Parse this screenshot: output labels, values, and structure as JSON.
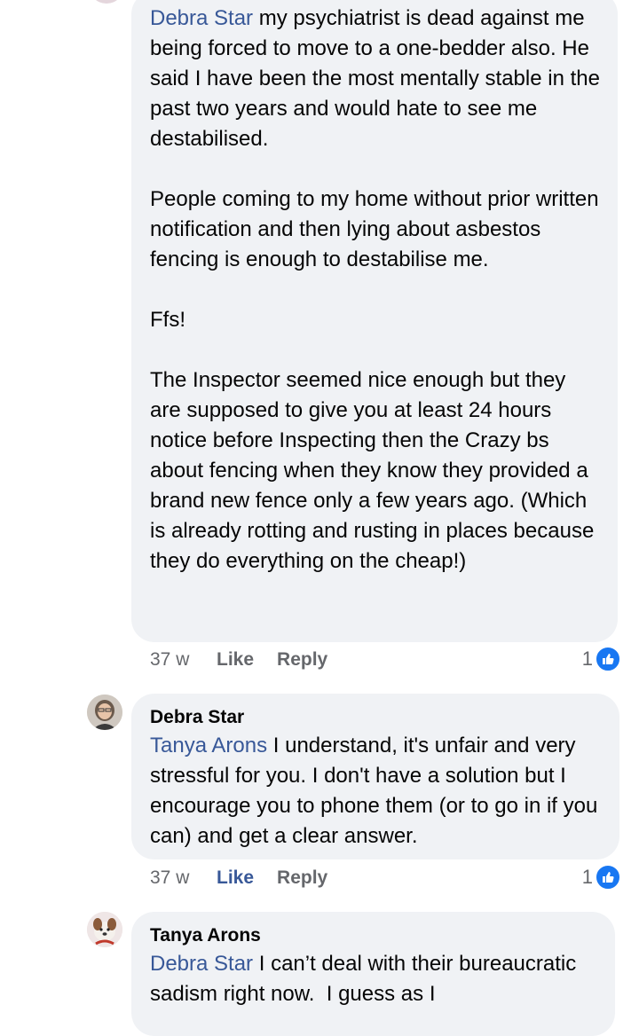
{
  "comments": [
    {
      "mention": "Debra Star",
      "paragraphs": [
        " my psychiatrist is dead against me being forced to move to a one-bedder also. He said I have been the most mentally stable in the past two years and would hate to see me destabilised.",
        "People coming to my home without prior written notification and then lying about asbestos fencing is enough to destabilise me.",
        "Ffs!",
        "The Inspector seemed nice enough but they are supposed to give you at least 24 hours notice before Inspecting then the Crazy bs about fencing when they know they provided a brand new fence only a few years ago. (Which is already rotting and rusting in places because they do everything on the cheap!)"
      ],
      "time": "37 w",
      "like_label": "Like",
      "reply_label": "Reply",
      "reaction_count": "1",
      "reaction_icon": "like-icon"
    },
    {
      "author": "Debra Star",
      "mention": "Tanya Arons",
      "text": " I understand, it's unfair and very stressful for you. I don't have a solution but I encourage you to phone them (or to go in if you can) and get a clear answer.",
      "time": "37 w",
      "like_label": "Like",
      "liked": true,
      "reply_label": "Reply",
      "reaction_count": "1",
      "reaction_icon": "like-icon"
    },
    {
      "author": "Tanya Arons",
      "mention": "Debra Star",
      "text": " I can’t deal with their bureaucratic sadism right now.  I guess as I"
    }
  ],
  "colors": {
    "mention": "#385898",
    "bubble": "#f0f2f5",
    "like_badge": "#1877f2",
    "meta_text": "#65676b"
  }
}
